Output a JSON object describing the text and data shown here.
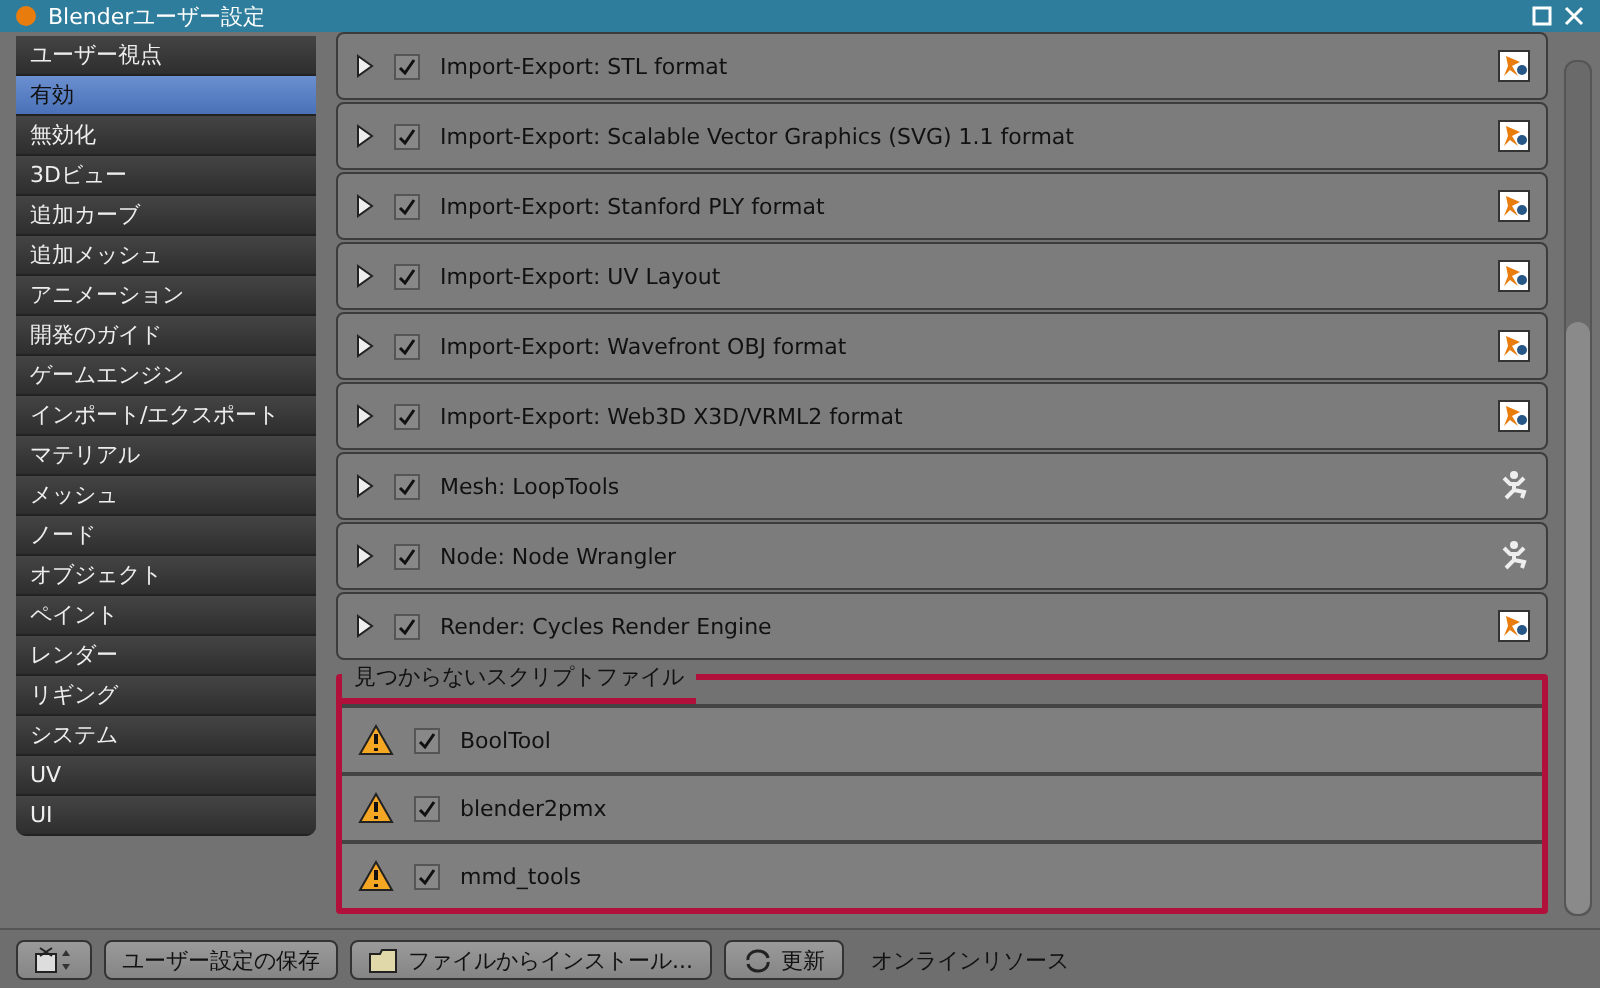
{
  "window": {
    "title": "Blenderユーザー設定"
  },
  "sidebar": {
    "items": [
      {
        "label": "ユーザー視点",
        "selected": false
      },
      {
        "label": "有効",
        "selected": true
      },
      {
        "label": "無効化",
        "selected": false
      },
      {
        "label": "3Dビュー",
        "selected": false
      },
      {
        "label": "追加カーブ",
        "selected": false
      },
      {
        "label": "追加メッシュ",
        "selected": false
      },
      {
        "label": "アニメーション",
        "selected": false
      },
      {
        "label": "開発のガイド",
        "selected": false
      },
      {
        "label": "ゲームエンジン",
        "selected": false
      },
      {
        "label": "インポート/エクスポート",
        "selected": false
      },
      {
        "label": "マテリアル",
        "selected": false
      },
      {
        "label": "メッシュ",
        "selected": false
      },
      {
        "label": "ノード",
        "selected": false
      },
      {
        "label": "オブジェクト",
        "selected": false
      },
      {
        "label": "ペイント",
        "selected": false
      },
      {
        "label": "レンダー",
        "selected": false
      },
      {
        "label": "リギング",
        "selected": false
      },
      {
        "label": "システム",
        "selected": false
      },
      {
        "label": "UV",
        "selected": false
      },
      {
        "label": "UI",
        "selected": false
      }
    ]
  },
  "addons": [
    {
      "name": "Import-Export: STL format",
      "checked": true,
      "kind": "official"
    },
    {
      "name": "Import-Export: Scalable Vector Graphics (SVG) 1.1 format",
      "checked": true,
      "kind": "official"
    },
    {
      "name": "Import-Export: Stanford PLY format",
      "checked": true,
      "kind": "official"
    },
    {
      "name": "Import-Export: UV Layout",
      "checked": true,
      "kind": "official"
    },
    {
      "name": "Import-Export: Wavefront OBJ format",
      "checked": true,
      "kind": "official"
    },
    {
      "name": "Import-Export: Web3D X3D/VRML2 format",
      "checked": true,
      "kind": "official"
    },
    {
      "name": "Mesh: LoopTools",
      "checked": true,
      "kind": "community"
    },
    {
      "name": "Node: Node Wrangler",
      "checked": true,
      "kind": "community"
    },
    {
      "name": "Render: Cycles Render Engine",
      "checked": true,
      "kind": "official"
    }
  ],
  "missing_scripts": {
    "title": "見つからないスクリプトファイル",
    "items": [
      {
        "name": "BoolTool",
        "checked": true
      },
      {
        "name": "blender2pmx",
        "checked": true
      },
      {
        "name": "mmd_tools",
        "checked": true
      }
    ]
  },
  "footer": {
    "save_button": "ユーザー設定の保存",
    "install_button": "ファイルからインストール...",
    "refresh_button": "更新",
    "online_link": "オンラインリソース"
  }
}
